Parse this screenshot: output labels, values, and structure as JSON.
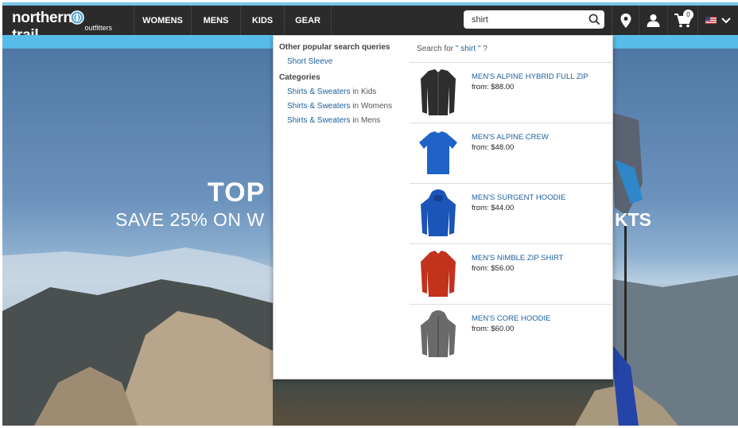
{
  "header": {
    "logo": {
      "main": "northern",
      "main_tail": "trail",
      "sub": "outfitters"
    },
    "nav": [
      "WOMENS",
      "MENS",
      "KIDS",
      "GEAR"
    ],
    "search": {
      "value": "shirt",
      "icon": "search-icon"
    },
    "icons": [
      "location-pin-icon",
      "account-icon",
      "cart-icon",
      "us-flag-icon",
      "chevron-down-icon"
    ],
    "cart_count": "0"
  },
  "hero": {
    "title": "TOP",
    "subtitle": "SAVE 25% ON W",
    "subtitle_tail": "KTS"
  },
  "dropdown": {
    "popular_heading": "Other popular search queries",
    "popular": [
      "Short Sleeve"
    ],
    "categories_heading": "Categories",
    "categories": [
      {
        "link": "Shirts & Sweaters",
        "suffix": " in Kids"
      },
      {
        "link": "Shirts & Sweaters",
        "suffix": " in Womens"
      },
      {
        "link": "Shirts & Sweaters",
        "suffix": " in Mens"
      }
    ],
    "search_for_prefix": "Search for",
    "search_for_query": "\" shirt \"",
    "search_for_suffix": " ?",
    "products": [
      {
        "name": "MEN'S ALPINE HYBRID FULL ZIP",
        "price": "from: $88.00",
        "color": "#2e2e2e"
      },
      {
        "name": "MEN'S ALPINE CREW",
        "price": "from: $48.00",
        "color": "#1f63c9"
      },
      {
        "name": "MEN'S SURGENT HOODIE",
        "price": "from: $44.00",
        "color": "#1c55b8"
      },
      {
        "name": "MEN'S NIMBLE ZIP SHIRT",
        "price": "from: $56.00",
        "color": "#c2321d"
      },
      {
        "name": "MEN'S CORE HOODIE",
        "price": "from: $60.00",
        "color": "#6a6a6a"
      }
    ]
  },
  "colors": {
    "header_bg": "#2b2b2b",
    "promo_bar": "#57bce9",
    "link": "#1a5f9e"
  }
}
